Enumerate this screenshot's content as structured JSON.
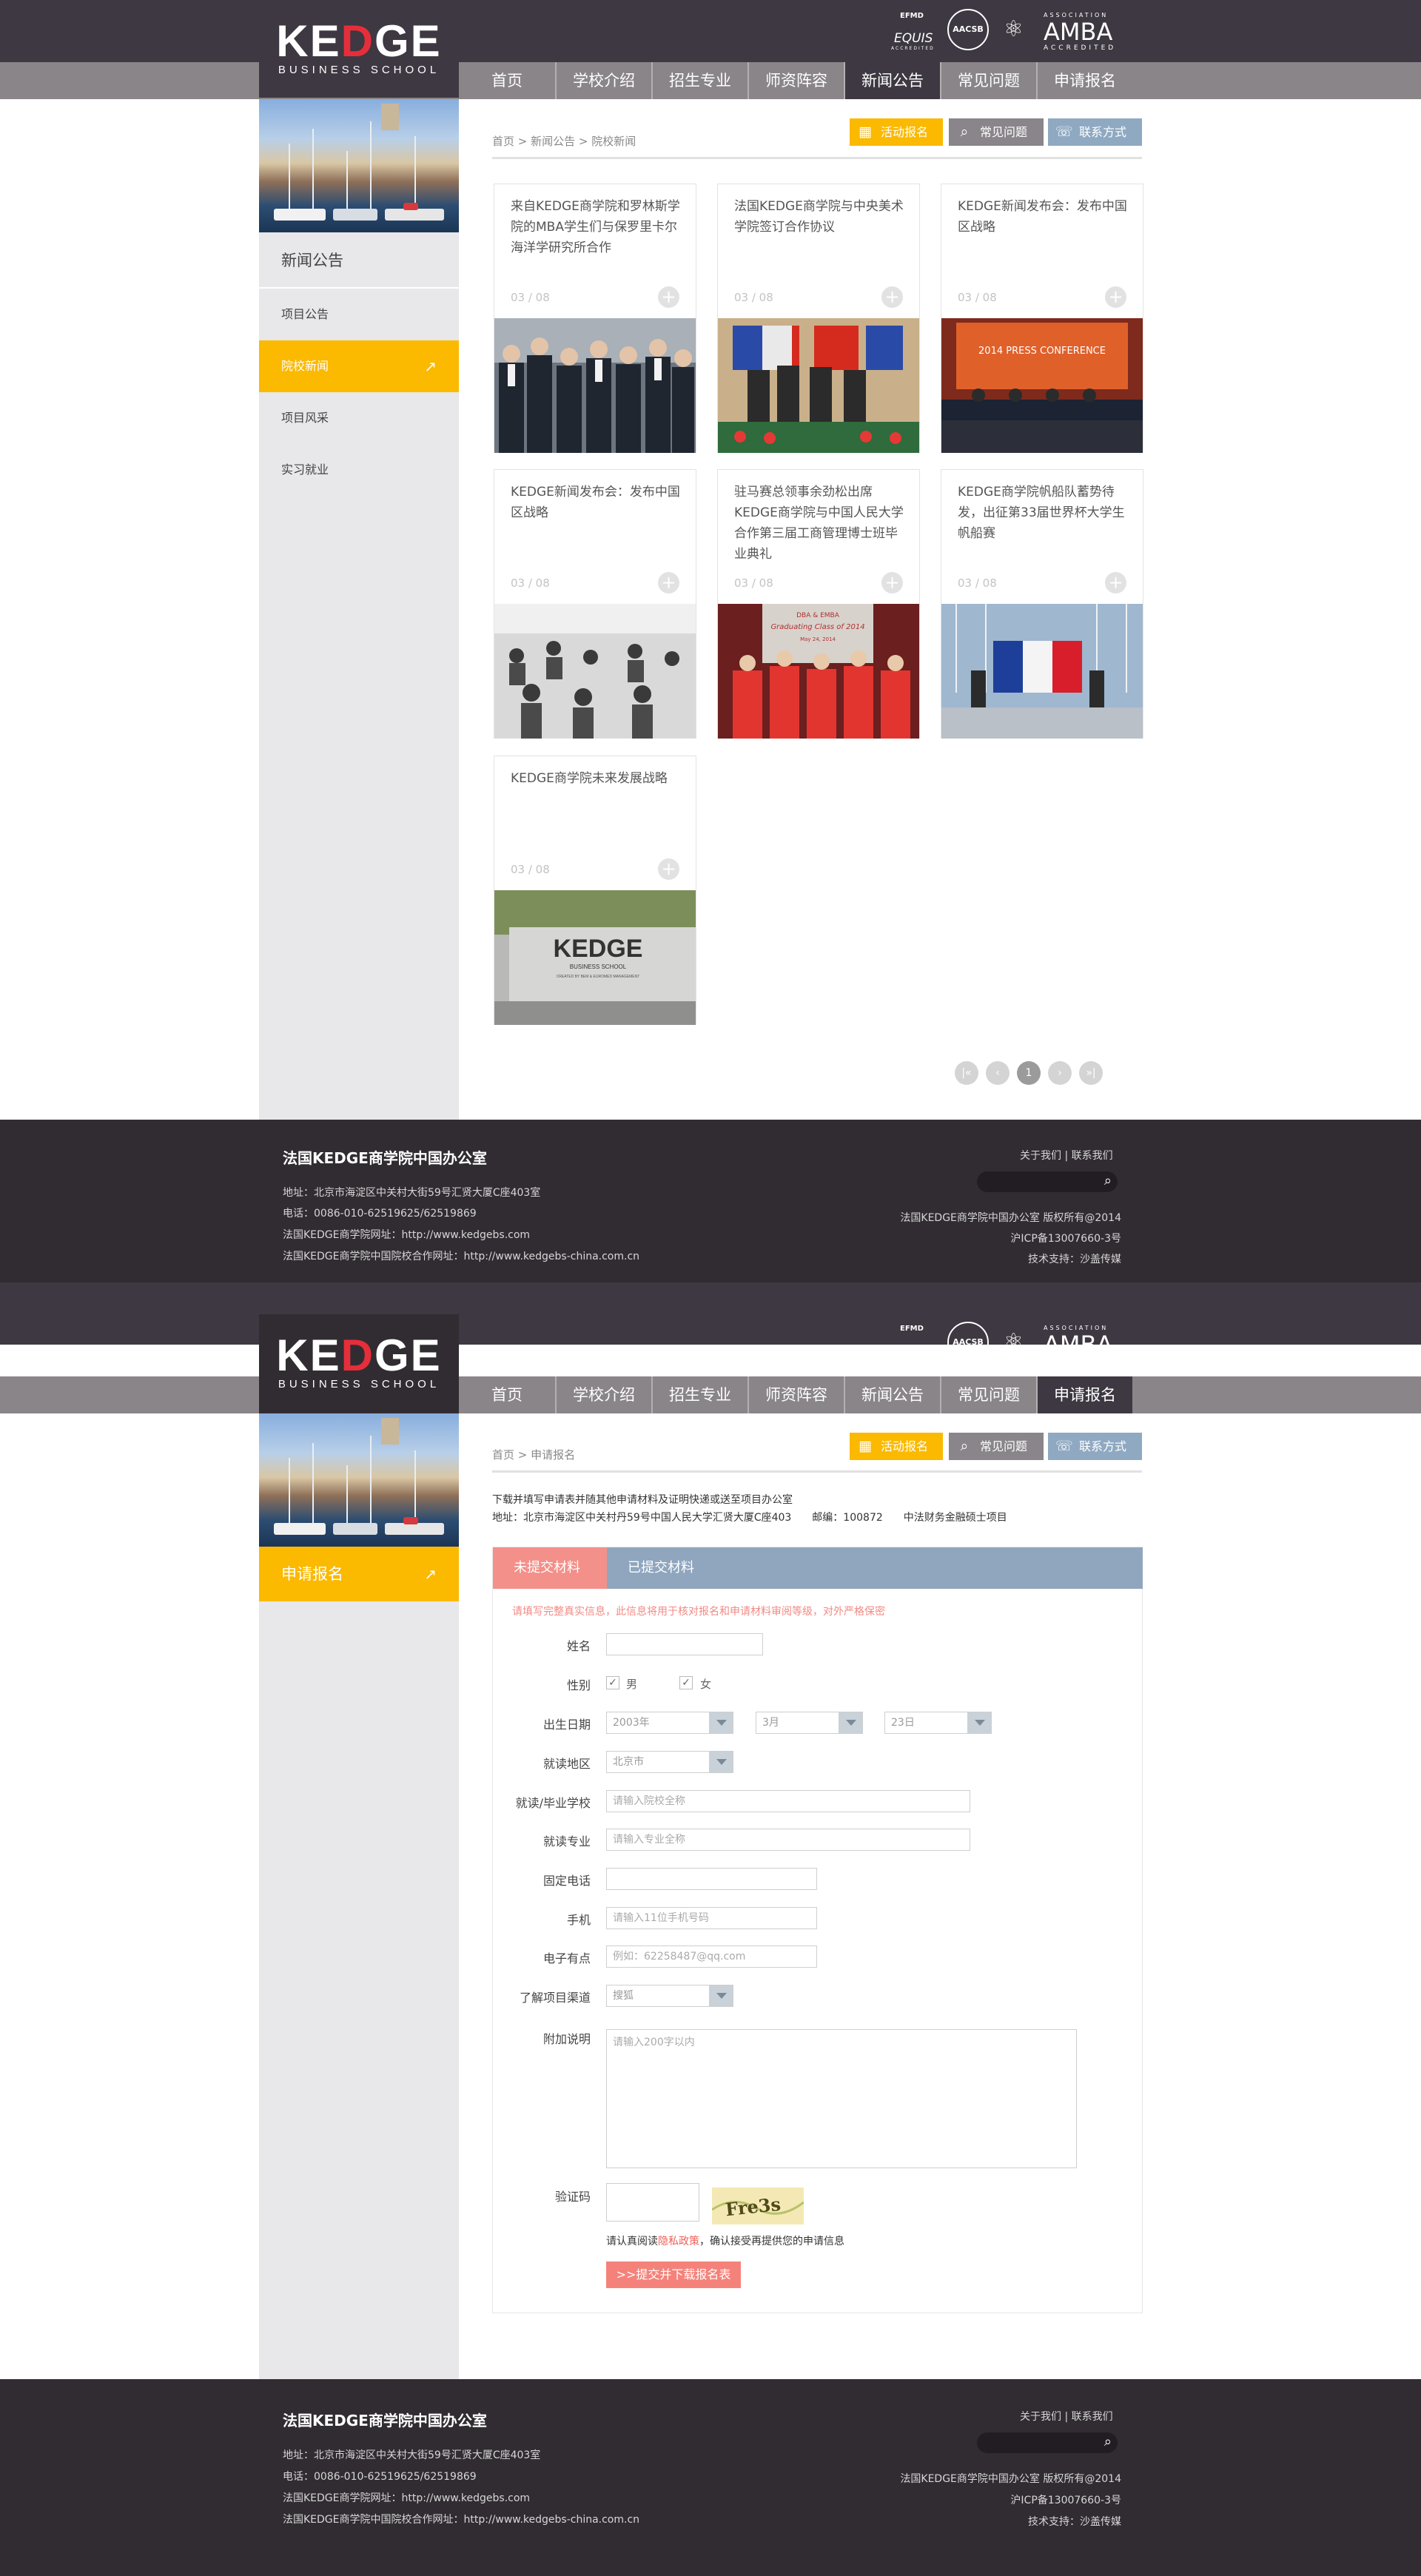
{
  "brand": {
    "logo_main_a": "KE",
    "logo_main_red": "D",
    "logo_main_b": "GE",
    "logo_sub": "BUSINESS SCHOOL"
  },
  "accreditations": {
    "equis_top": "EFMD",
    "equis_name": "EQUIS",
    "equis_sub": "ACCREDITED",
    "aacsb": "AACSB",
    "amba_top": "ASSOCIATION",
    "amba_name": "AMBA",
    "amba_sub": "ACCREDITED"
  },
  "nav": [
    "首页",
    "学校介绍",
    "招生专业",
    "师资阵容",
    "新闻公告",
    "常见问题",
    "申请报名"
  ],
  "quick_buttons": {
    "event": "活动报名",
    "faq": "常见问题",
    "contact": "联系方式"
  },
  "news_page": {
    "active_nav": 4,
    "breadcrumb": "首页 > 新闻公告 > 院校新闻",
    "sidebar": {
      "title": "新闻公告",
      "items": [
        "项目公告",
        "院校新闻",
        "项目风采",
        "实习就业"
      ],
      "active": 1
    },
    "cards": [
      {
        "title": "来自KEDGE商学院和罗林斯学院的MBA学生们与保罗里卡尔海洋学研究所合作",
        "date": "03 / 08"
      },
      {
        "title": "法国KEDGE商学院与中央美术学院签订合作协议",
        "date": "03 / 08"
      },
      {
        "title": "KEDGE新闻发布会：发布中国区战略",
        "date": "03 / 08"
      },
      {
        "title": "KEDGE新闻发布会：发布中国区战略",
        "date": "03 / 08"
      },
      {
        "title": "驻马赛总领事余劲松出席KEDGE商学院与中国人民大学合作第三届工商管理博士班毕业典礼",
        "date": "03 / 08"
      },
      {
        "title": "KEDGE商学院帆船队蓄势待发，出征第33届世界杯大学生帆船赛",
        "date": "03 / 08"
      },
      {
        "title": "KEDGE商学院未来发展战略",
        "date": "03 / 08"
      }
    ],
    "card_photo_texts": {
      "press_banner": "2014 PRESS CONFERENCE",
      "grad_banner_1": "DBA & EMBA",
      "grad_banner_2": "Graduating Class of 2014",
      "grad_banner_3": "May 24, 2014",
      "sign_main": "KEDGE",
      "sign_sub": "BUSINESS SCHOOL",
      "sign_small": "CREATED BY BEM & EUROMED MANAGEMENT"
    },
    "pager": {
      "first": "|«",
      "prev": "‹",
      "current": "1",
      "next": "›",
      "last": "»|"
    }
  },
  "apply_page": {
    "active_nav": 6,
    "breadcrumb": "首页 > 申请报名",
    "sidebar": {
      "title": "申请报名"
    },
    "intro_1": "下载并填写申请表并随其他申请材料及证明快递或送至项目办公室",
    "intro_2": "地址：北京市海淀区中关村丹59号中国人民大学汇贤大厦C座403　　邮编：100872　　中法财务金融硕士项目",
    "tabs": [
      "未提交材料",
      "已提交材料"
    ],
    "notice": "请填写完整真实信息，此信息将用于核对报名和申请材料审阅等级，对外严格保密",
    "labels": {
      "name": "姓名",
      "gender": "性别",
      "birth": "出生日期",
      "region": "就读地区",
      "school": "就读/毕业学校",
      "major": "就读专业",
      "phone": "固定电话",
      "mobile": "手机",
      "email": "电子有点",
      "channel": "了解项目渠道",
      "extra": "附加说明",
      "captcha": "验证码"
    },
    "gender_male": "男",
    "gender_female": "女",
    "check_mark": "✓",
    "birth_year": "2003年",
    "birth_month": "3月",
    "birth_day": "23日",
    "region_value": "北京市",
    "school_placeholder": "请输入院校全称",
    "major_placeholder": "请输入专业全称",
    "mobile_placeholder": "请输入11位手机号码",
    "email_placeholder": "例如：62258487@qq.com",
    "channel_value": "搜狐",
    "extra_placeholder": "请输入200字以内",
    "captcha_text": "Fre3s",
    "agree_before": "请认真阅读",
    "agree_link": "隐私政策",
    "agree_after": "，确认接受再提供您的申请信息",
    "submit": ">>提交并下载报名表"
  },
  "footer": {
    "title": "法国KEDGE商学院中国办公室",
    "address": "地址：北京市海淀区中关村大街59号汇贤大厦C座403室",
    "phone": "电话：0086-010-62519625/62519869",
    "site": "法国KEDGE商学院网址：http://www.kedgebs.com",
    "site_cn": "法国KEDGE商学院中国院校合作网址：http://www.kedgebs-china.com.cn",
    "links": "关于我们 | 联系我们",
    "copyright": "法国KEDGE商学院中国办公室 版权所有@2014",
    "icp": "沪ICP备13007660-3号",
    "support": "技术支持：沙盖传媒"
  },
  "colors": {
    "dark": "#3d3841",
    "nav_gray": "#898589",
    "accent_yellow": "#fbb900",
    "salmon": "#f39089",
    "steel": "#8fa6be"
  },
  "icons": {
    "event": "calendar-icon",
    "faq": "search-icon",
    "contact": "phone-icon",
    "nav_arrow": "arrow-up-right-icon"
  }
}
